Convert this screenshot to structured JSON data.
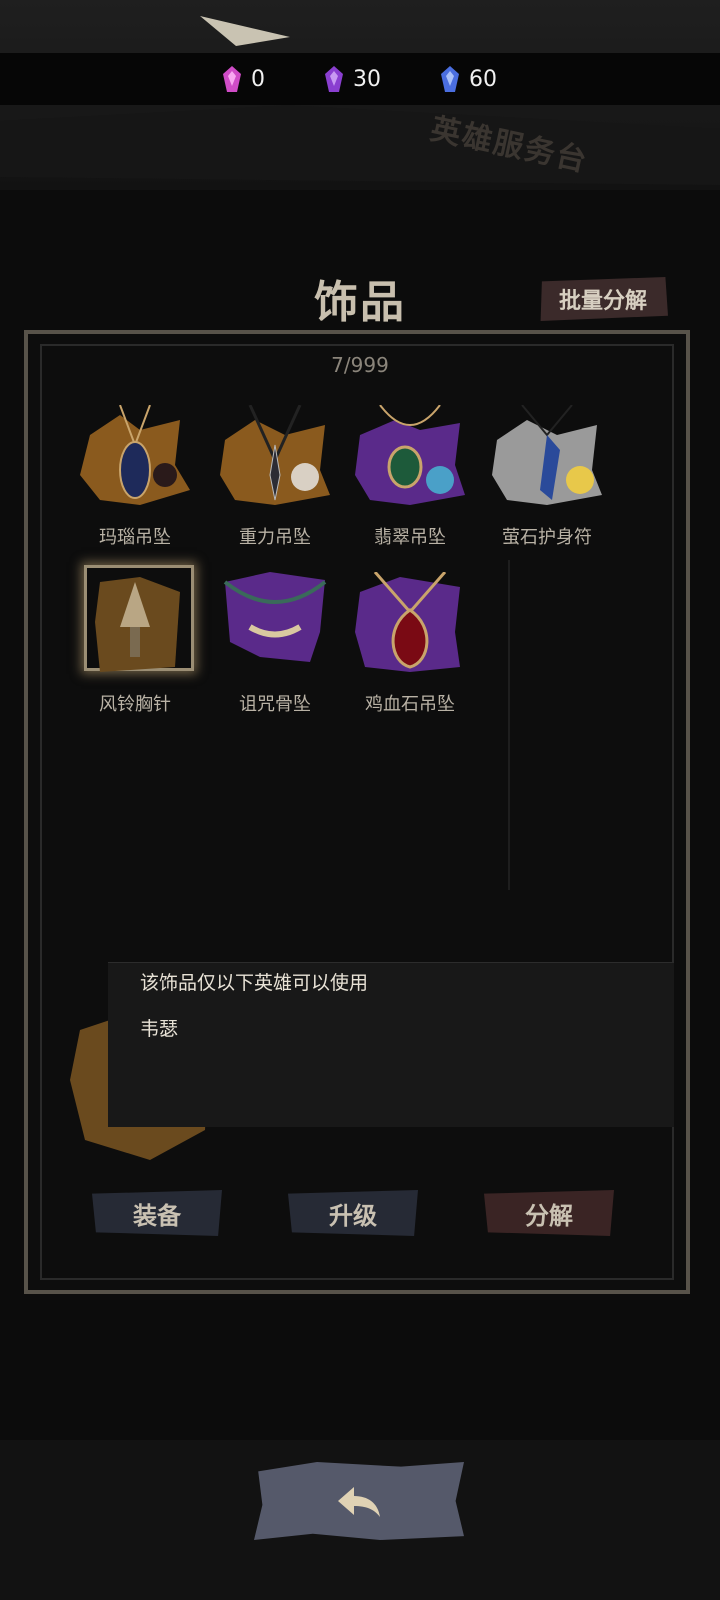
{
  "currencies": [
    {
      "icon": "pink-crystal-icon",
      "value": "0",
      "color": "#d04cc7"
    },
    {
      "icon": "purple-crystal-icon",
      "value": "30",
      "color": "#8a3fd0"
    },
    {
      "icon": "blue-crystal-icon",
      "value": "60",
      "color": "#4a6ee0"
    }
  ],
  "banner": "英雄服务台",
  "page_title": "饰品",
  "bulk_decompose_label": "批量分解",
  "item_count": "7/999",
  "items": [
    {
      "label": "玛瑙吊坠",
      "icon": "agate-pendant-icon",
      "bg": "#8a5a1e"
    },
    {
      "label": "重力吊坠",
      "icon": "gravity-pendant-icon",
      "bg": "#8a5a1e"
    },
    {
      "label": "翡翠吊坠",
      "icon": "emerald-pendant-icon",
      "bg": "#5a2a8a"
    },
    {
      "label": "萤石护身符",
      "icon": "fluorite-amulet-icon",
      "bg": "#9a9a9a"
    },
    {
      "label": "风铃胸针",
      "icon": "windchime-brooch-icon",
      "bg": "#8a5a1e"
    },
    {
      "label": "诅咒骨坠",
      "icon": "cursed-bone-pendant-icon",
      "bg": "#5a2a8a"
    },
    {
      "label": "鸡血石吊坠",
      "icon": "bloodstone-pendant-icon",
      "bg": "#5a2a8a"
    }
  ],
  "tooltip": {
    "heading": "该饰品仅以下英雄可以使用",
    "hero": "韦瑟"
  },
  "actions": {
    "equip": "装备",
    "upgrade": "升级",
    "decompose": "分解"
  },
  "colors": {
    "equip_bg": "#262a35",
    "upgrade_bg": "#262a35",
    "decompose_bg": "#3a2424"
  },
  "back_icon": "back-arrow-icon"
}
